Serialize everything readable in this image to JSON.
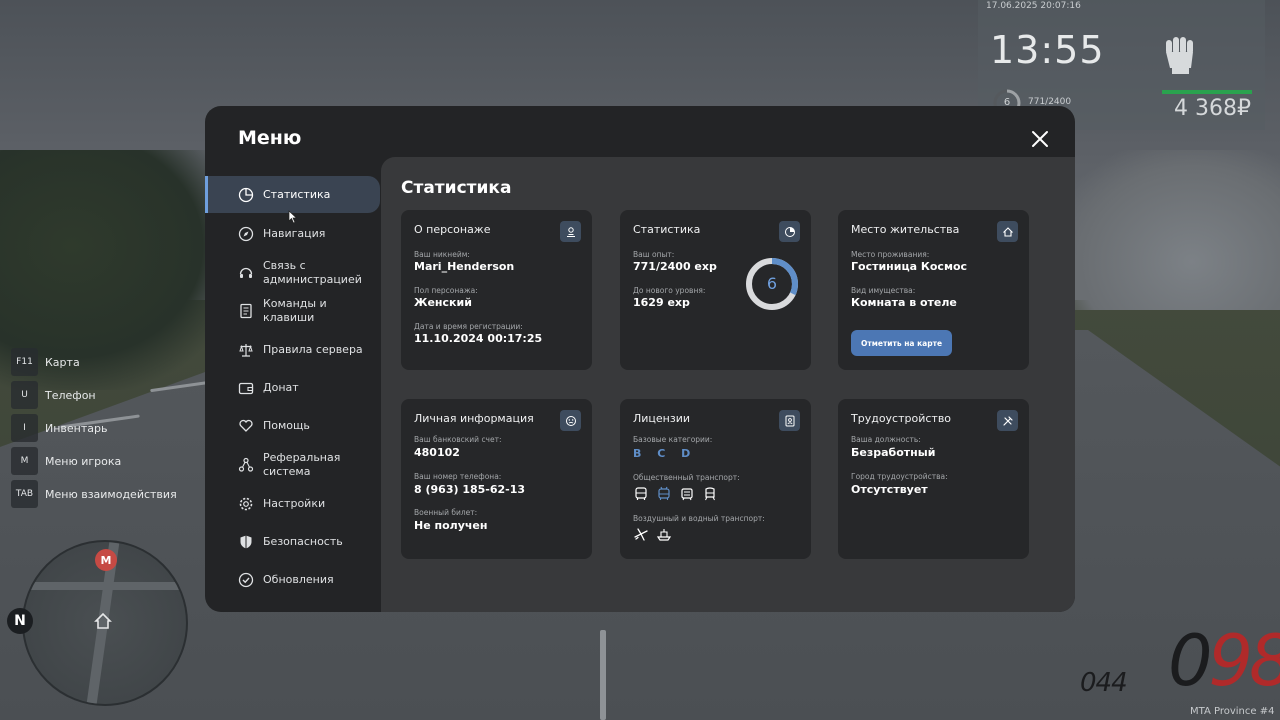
{
  "hud": {
    "datetime": "17.06.2025 20:07:16",
    "time": "13:55",
    "level": "6",
    "exp": "771/2400",
    "money": "4 368₽"
  },
  "hotkeys": [
    {
      "key": "F11",
      "label": "Карта"
    },
    {
      "key": "U",
      "label": "Телефон"
    },
    {
      "key": "I",
      "label": "Инвентарь"
    },
    {
      "key": "M",
      "label": "Меню игрока"
    },
    {
      "key": "TAB",
      "label": "Меню взаимодействия"
    }
  ],
  "minimap": {
    "compass": "N",
    "metro": "M"
  },
  "speedometer": {
    "speed_prefix": "0",
    "speed_value": "98",
    "fuel": "044"
  },
  "watermark": "MTA Province #4",
  "menu": {
    "title": "Меню",
    "sidebar": [
      {
        "label": "Статистика",
        "icon": "pie-chart-icon",
        "active": true
      },
      {
        "label": "Навигация",
        "icon": "compass-icon"
      },
      {
        "label": "Связь с администрацией",
        "icon": "headset-icon"
      },
      {
        "label": "Команды и клавиши",
        "icon": "document-icon"
      },
      {
        "label": "Правила сервера",
        "icon": "scales-icon"
      },
      {
        "label": "Донат",
        "icon": "wallet-icon"
      },
      {
        "label": "Помощь",
        "icon": "heart-hand-icon"
      },
      {
        "label": "Реферальная система",
        "icon": "network-icon"
      },
      {
        "label": "Настройки",
        "icon": "gear-icon"
      },
      {
        "label": "Безопасность",
        "icon": "shield-icon"
      },
      {
        "label": "Обновления",
        "icon": "check-circle-icon"
      }
    ],
    "content_title": "Статистика",
    "cards": {
      "character": {
        "title": "О персонаже",
        "nickname_label": "Ваш никнейм:",
        "nickname": "Mari_Henderson",
        "gender_label": "Пол персонажа:",
        "gender": "Женский",
        "reg_label": "Дата и время регистрации:",
        "reg": "11.10.2024 00:17:25"
      },
      "stats": {
        "title": "Статистика",
        "exp_label": "Ваш опыт:",
        "exp": "771/2400 exp",
        "next_label": "До нового уровня:",
        "next": "1629 exp",
        "level": "6",
        "progress": 0.32
      },
      "residence": {
        "title": "Место жительства",
        "place_label": "Место проживания:",
        "place": "Гостиница Космос",
        "type_label": "Вид имущества:",
        "type": "Комната в отеле",
        "button": "Отметить на карте"
      },
      "personal": {
        "title": "Личная информация",
        "bank_label": "Ваш банковский счет:",
        "bank": "480102",
        "phone_label": "Ваш номер телефона:",
        "phone": "8 (963) 185-62-13",
        "military_label": "Военный билет:",
        "military": "Не получен"
      },
      "licenses": {
        "title": "Лицензии",
        "basic_label": "Базовые категории:",
        "basic": "B C D",
        "public_label": "Общественный транспорт:",
        "air_label": "Воздушный и водный транспорт:"
      },
      "employment": {
        "title": "Трудоустройство",
        "position_label": "Ваша должность:",
        "position": "Безработный",
        "city_label": "Город трудоустройства:",
        "city": "Отсутствует"
      }
    }
  },
  "colors": {
    "accent": "#6f9fdd",
    "button": "#4c77b4",
    "panel": "#232426",
    "content": "#38393b",
    "card": "#262729"
  }
}
